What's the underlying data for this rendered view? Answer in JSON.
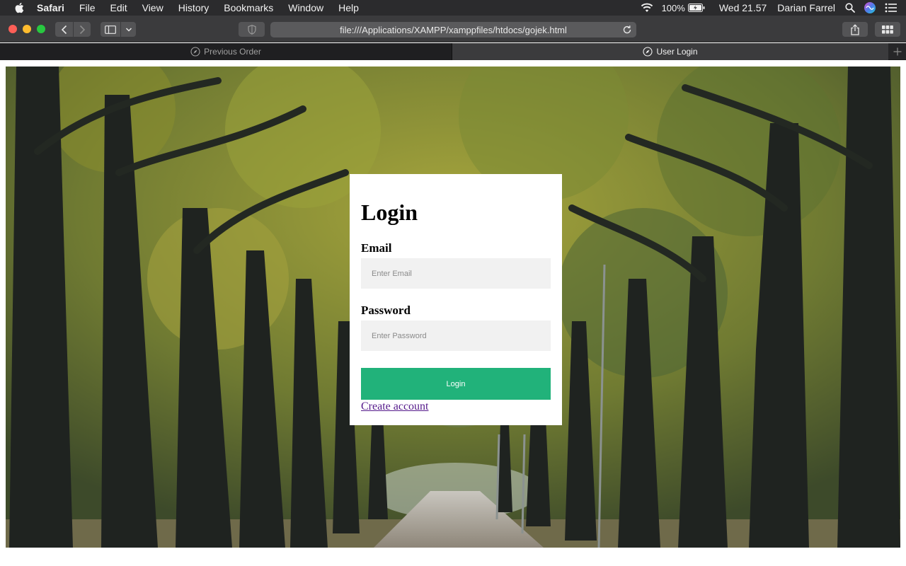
{
  "menubar": {
    "app_name": "Safari",
    "items": [
      "File",
      "Edit",
      "View",
      "History",
      "Bookmarks",
      "Window",
      "Help"
    ],
    "battery_percent": "100%",
    "clock": "Wed 21.57",
    "user_name": "Darian Farrel"
  },
  "toolbar": {
    "url": "file:///Applications/XAMPP/xamppfiles/htdocs/gojek.html"
  },
  "tabs": [
    {
      "label": "Previous Order",
      "active": false
    },
    {
      "label": "User Login",
      "active": true
    }
  ],
  "login": {
    "title": "Login",
    "email_label": "Email",
    "email_placeholder": "Enter Email",
    "email_value": "",
    "password_label": "Password",
    "password_placeholder": "Enter Password",
    "password_value": "",
    "submit_label": "Login",
    "create_account_label": "Create account"
  },
  "colors": {
    "login_button": "#21b27a",
    "link_visited": "#551a8b",
    "input_background": "#f1f1f1"
  },
  "icons": [
    "apple-icon",
    "wifi-icon",
    "battery-icon",
    "spotlight-search-icon",
    "siri-icon",
    "notification-center-icon",
    "back-icon",
    "forward-icon",
    "sidebar-icon",
    "chevron-down-icon",
    "privacy-shield-icon",
    "reload-icon",
    "share-icon",
    "tab-overview-icon",
    "compass-icon",
    "plus-icon"
  ]
}
